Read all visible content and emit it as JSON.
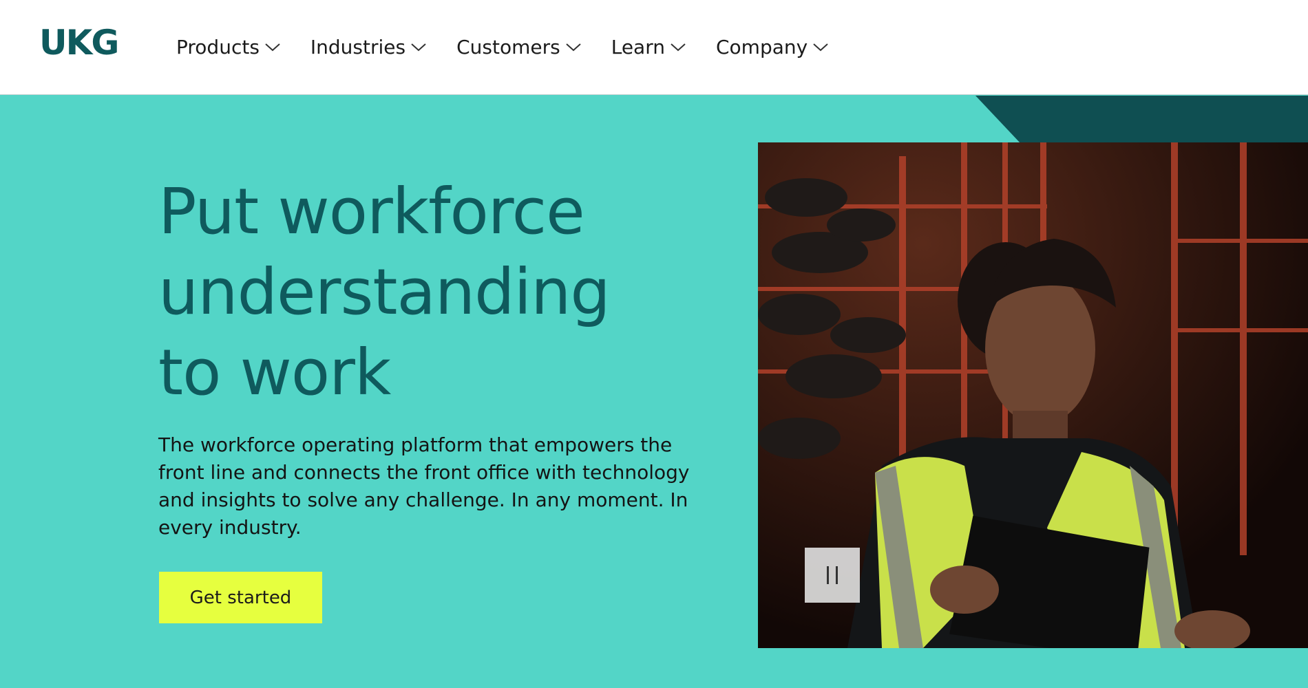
{
  "brand": {
    "logo_text": "UKG",
    "primary_color": "#0f5a5d",
    "accent_color": "#53d5c7",
    "cta_color": "#e6ff3f"
  },
  "nav": {
    "items": [
      {
        "label": "Products",
        "icon": "chevron-down-icon"
      },
      {
        "label": "Industries",
        "icon": "chevron-down-icon"
      },
      {
        "label": "Customers",
        "icon": "chevron-down-icon"
      },
      {
        "label": "Learn",
        "icon": "chevron-down-icon"
      },
      {
        "label": "Company",
        "icon": "chevron-down-icon"
      }
    ]
  },
  "hero": {
    "headline_lines": [
      "Put workforce",
      "understanding",
      "to work"
    ],
    "subcopy": "The workforce operating platform that empowers the front line and connects the front office with technology and insights to solve any challenge. In any moment. In every industry.",
    "cta_label": "Get started",
    "video": {
      "pause_icon": "pause-icon"
    }
  }
}
